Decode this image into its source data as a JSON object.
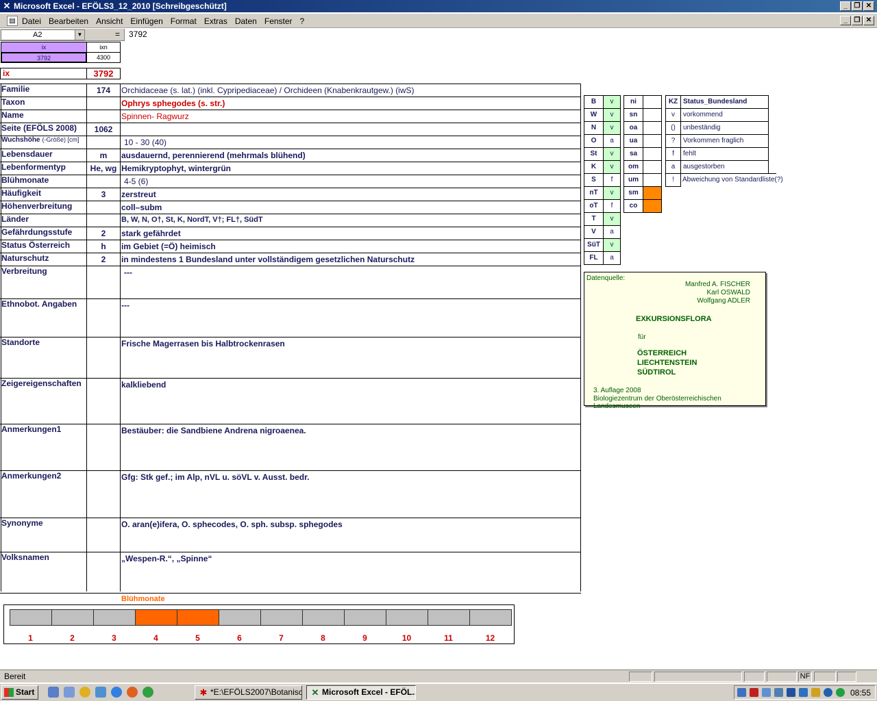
{
  "window": {
    "title": "Microsoft Excel - EFÖLS3_12_2010  [Schreibgeschützt]"
  },
  "menu": [
    "Datei",
    "Bearbeiten",
    "Ansicht",
    "Einfügen",
    "Format",
    "Extras",
    "Daten",
    "Fenster",
    "?"
  ],
  "formula_bar": {
    "name_box": "A2",
    "equals": "=",
    "value": "3792"
  },
  "header_cells": {
    "ix_label": "ix",
    "ixn_label": "ixn",
    "ix_value": "3792",
    "ixn_value": "4300",
    "ix_big_label": "ix",
    "ix_big_value": "3792"
  },
  "rows": [
    {
      "label": "Familie",
      "num": "174",
      "value": "Orchidaceae (s. lat.) (inkl. Cypripediaceae)  /  Orchideen (Knabenkrautgew.) (iwS)"
    },
    {
      "label": "Taxon",
      "num": "",
      "value": "Ophrys sphegodes (s. str.)"
    },
    {
      "label": "Name",
      "num": "",
      "value": "Spinnen- Ragwurz"
    },
    {
      "label": "Seite (EFÖLS 2008)",
      "num": "1062",
      "value": ""
    },
    {
      "label": "Wuchshöhe",
      "label_suffix": "(-Größe) [cm]",
      "num": "",
      "value": "10 - 30 (40)"
    },
    {
      "label": "Lebensdauer",
      "num": "m",
      "value": "ausdauernd, perennierend (mehrmals blühend)"
    },
    {
      "label": "Lebenformentyp",
      "num": "He, wg",
      "value": "Hemikryptophyt, wintergrün"
    },
    {
      "label": "Blühmonate",
      "num": "",
      "value": "4-5 (6)"
    },
    {
      "label": "Häufigkeit",
      "num": "3",
      "value": "zerstreut"
    },
    {
      "label": "Höhenverbreitung",
      "num": "",
      "value": "coll–subm"
    },
    {
      "label": "Länder",
      "num": "",
      "value": "B, W, N, O†, St, K, NordT, V†; FL†, SüdT"
    },
    {
      "label": "Gefährdungsstufe",
      "num": "2",
      "value": "stark gefährdet"
    },
    {
      "label": "Status Österreich",
      "num": "h",
      "value": "im Gebiet (=Ö) heimisch"
    },
    {
      "label": "Naturschutz",
      "num": "2",
      "value": "in mindestens 1 Bundesland unter vollständigem gesetzlichen Naturschutz"
    },
    {
      "label": "Verbreitung",
      "num": "",
      "value": "---"
    },
    {
      "label": "Ethnobot. Angaben",
      "num": "",
      "value": "---"
    },
    {
      "label": "Standorte",
      "num": "",
      "value": "Frische Magerrasen bis Halbtrockenrasen"
    },
    {
      "label": "Zeigereigenschaften",
      "num": "",
      "value": "kalkliebend"
    },
    {
      "label": "Anmerkungen1",
      "num": "",
      "value": "Bestäuber: die Sandbiene Andrena nigroaenea."
    },
    {
      "label": "Anmerkungen2",
      "num": "",
      "value": "Gfg:  Stk gef.; im Alp, nVL u. söVL v. Ausst. bedr."
    },
    {
      "label": "Synonyme",
      "num": "",
      "value": "O. aran(e)ifera, O. sphecodes, O. sph. subsp. sphegodes"
    },
    {
      "label": "Volksnamen",
      "num": "",
      "value": "„Wespen-R.“, „Spinne“"
    }
  ],
  "regions": [
    {
      "code": "B",
      "val": "v"
    },
    {
      "code": "W",
      "val": "v"
    },
    {
      "code": "N",
      "val": "v"
    },
    {
      "code": "O",
      "val": "a"
    },
    {
      "code": "St",
      "val": "v"
    },
    {
      "code": "K",
      "val": "v"
    },
    {
      "code": "S",
      "val": "f"
    },
    {
      "code": "nT",
      "val": "v"
    },
    {
      "code": "oT",
      "val": "f"
    },
    {
      "code": "T",
      "val": "v"
    },
    {
      "code": "V",
      "val": "a"
    },
    {
      "code": "SüT",
      "val": "v"
    },
    {
      "code": "FL",
      "val": "a"
    }
  ],
  "altitudes": [
    "ni",
    "sn",
    "oa",
    "ua",
    "sa",
    "om",
    "um",
    "sm",
    "co"
  ],
  "legend": {
    "header_kz": "KZ",
    "header_status": "Status_Bundesland",
    "items": [
      {
        "kz": "v",
        "text": "vorkommend"
      },
      {
        "kz": "()",
        "text": "unbeständig"
      },
      {
        "kz": "?",
        "text": "Vorkommen fraglich"
      },
      {
        "kz": "f",
        "text": "fehlt"
      },
      {
        "kz": "a",
        "text": "ausgestorben"
      },
      {
        "kz": "!",
        "text": "Abweichung von Standardliste(?)"
      }
    ]
  },
  "datenquelle": {
    "label": "Datenquelle:",
    "authors": [
      "Manfred A. FISCHER",
      "Karl OSWALD",
      "Wolfgang ADLER"
    ],
    "title": "EXKURSIONSFLORA",
    "fuer": "für",
    "countries": [
      "ÖSTERREICH",
      "LIECHTENSTEIN",
      "SÜDTIROL"
    ],
    "edition": "3. Auflage 2008",
    "publisher": "Biologiezentrum der Oberösterreichischen Landesmuseen"
  },
  "bloom": {
    "title": "Blühmonate",
    "months": [
      "1",
      "2",
      "3",
      "4",
      "5",
      "6",
      "7",
      "8",
      "9",
      "10",
      "11",
      "12"
    ],
    "active": [
      0,
      0,
      0,
      1,
      1,
      0,
      0,
      0,
      0,
      0,
      0,
      0
    ],
    "active_color": "#ff6600",
    "inactive_color": "#c0c0c0"
  },
  "status_bar": {
    "text": "Bereit",
    "nf": "NF"
  },
  "taskbar": {
    "start": "Start",
    "tasks": [
      "*E:\\EFÖLS2007\\Botanisc...",
      "Microsoft Excel - EFÖL..."
    ],
    "clock": "08:55"
  },
  "colors": {
    "title_bar": "#0a246a",
    "header_purple": "#cc99ff",
    "region_green": "#ccffcc",
    "orange": "#ff6600",
    "red_text": "#cc0000"
  }
}
